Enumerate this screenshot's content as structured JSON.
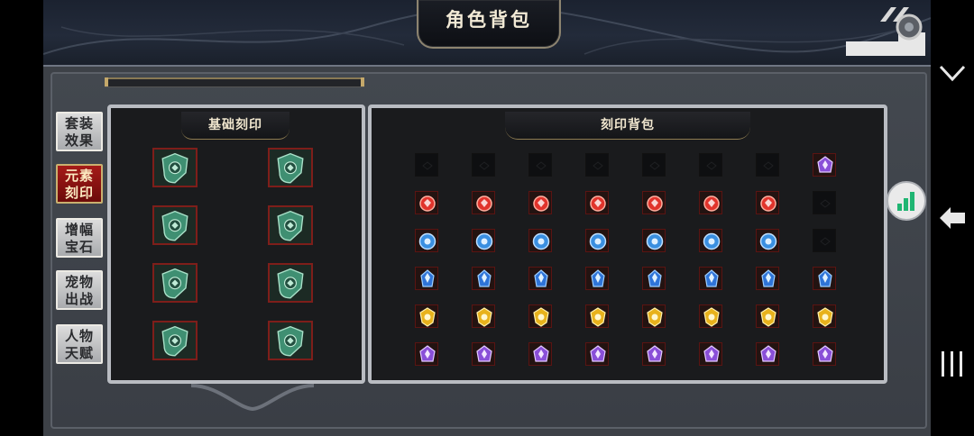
{
  "title": "角色背包",
  "side_tabs": [
    {
      "line1": "套装",
      "line2": "效果",
      "active": false
    },
    {
      "line1": "元素",
      "line2": "刻印",
      "active": true
    },
    {
      "line1": "增幅",
      "line2": "宝石",
      "active": false
    },
    {
      "line1": "宠物",
      "line2": "出战",
      "active": false
    },
    {
      "line1": "人物",
      "line2": "天赋",
      "active": false
    }
  ],
  "base_panel": {
    "title": "基础刻印",
    "slots": [
      "green-shield",
      "green-shield",
      "green-shield",
      "green-shield",
      "green-shield",
      "green-shield",
      "green-shield",
      "green-shield"
    ]
  },
  "bag_panel": {
    "title": "刻印背包",
    "rows": [
      [
        "empty",
        "empty",
        "empty",
        "empty",
        "empty",
        "empty",
        "empty",
        "purple"
      ],
      [
        "red",
        "red",
        "red",
        "red",
        "red",
        "red",
        "red",
        "empty"
      ],
      [
        "blue-round",
        "blue-round",
        "blue-round",
        "blue-round",
        "blue-round",
        "blue-round",
        "blue-round",
        "empty"
      ],
      [
        "blue-crystal",
        "blue-crystal",
        "blue-crystal",
        "blue-crystal",
        "blue-crystal",
        "blue-crystal",
        "blue-crystal",
        "blue-crystal"
      ],
      [
        "gold",
        "gold",
        "gold",
        "gold",
        "gold",
        "gold",
        "gold",
        "gold"
      ],
      [
        "purple",
        "purple",
        "purple",
        "purple",
        "purple",
        "purple",
        "purple",
        "purple"
      ]
    ]
  },
  "colors": {
    "red": "#e0342c",
    "blue-round": "#3a8fe0",
    "blue-crystal": "#2f74d8",
    "gold": "#e8b21c",
    "purple": "#8a4fd8",
    "green-shield": "#3f8f72",
    "active_tab": "#a51b18"
  },
  "icons": {
    "close": "close-icon",
    "side_right": "chevron-down-icon",
    "side_back": "back-arrow-icon",
    "side_menu": "menu-icon",
    "status": "signal-bars-icon"
  }
}
